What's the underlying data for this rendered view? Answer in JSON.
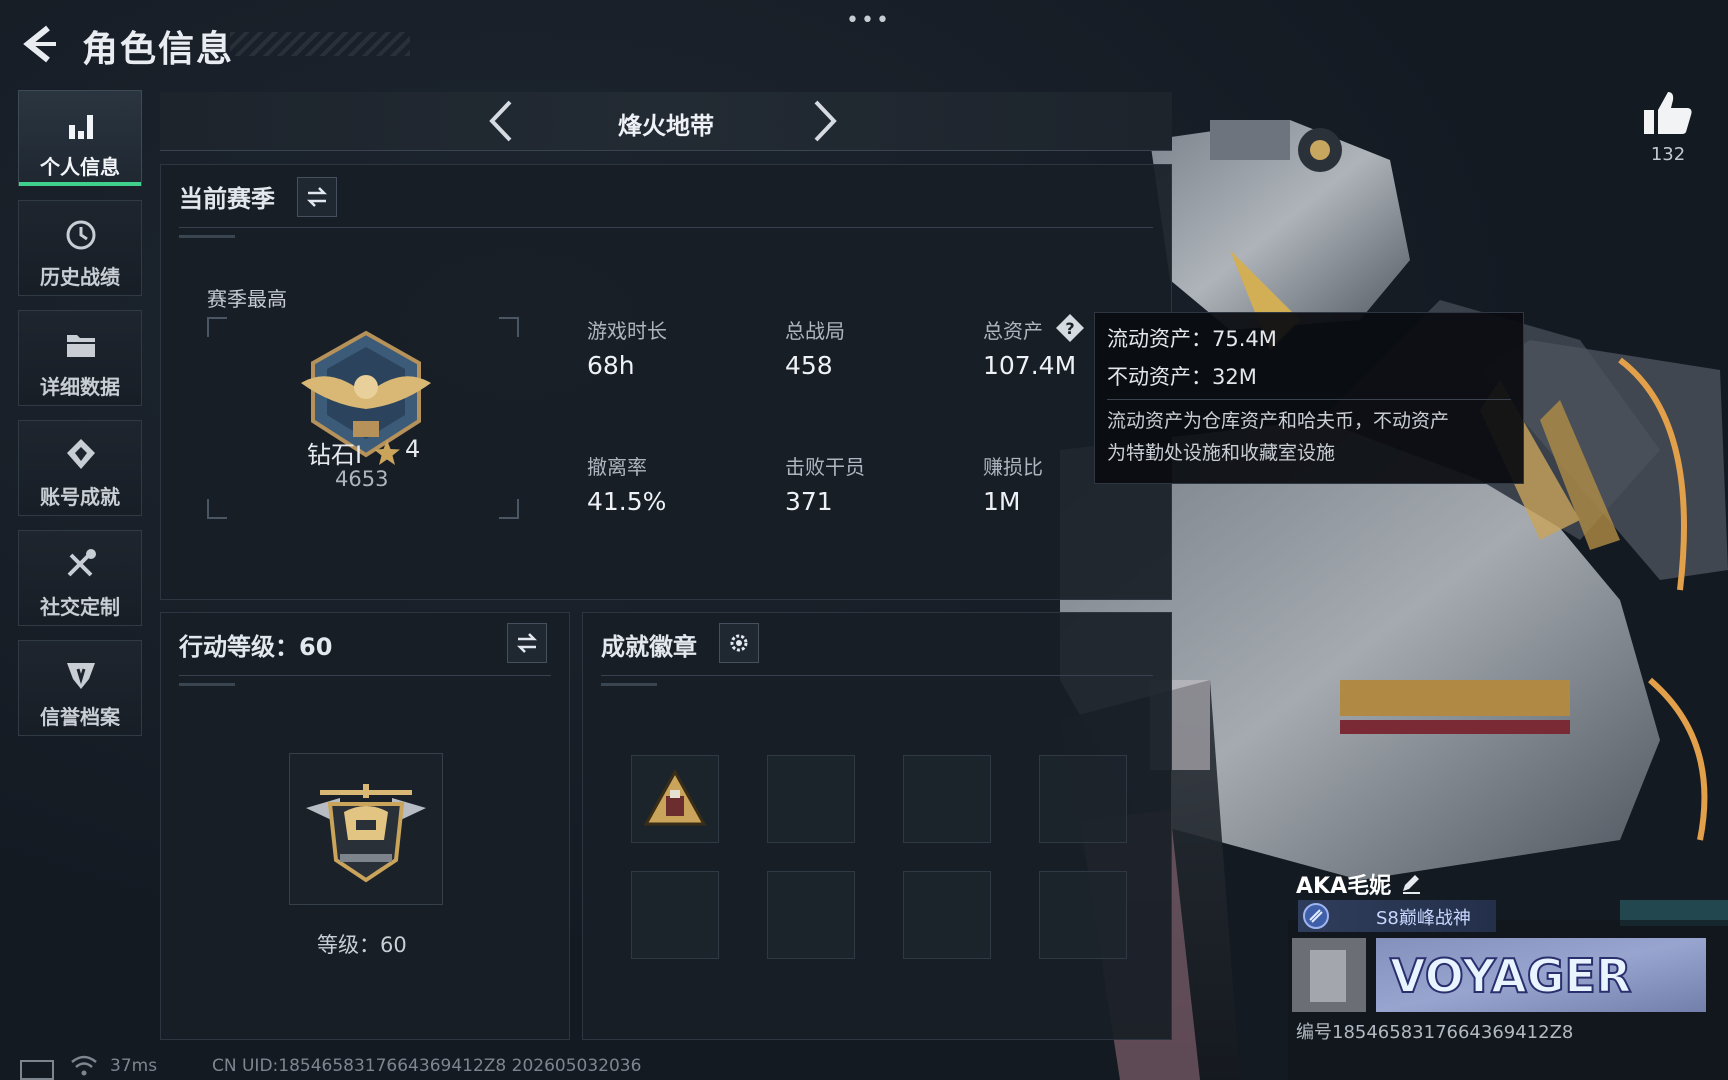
{
  "header": {
    "title": "角色信息",
    "menu_glyph": "•••"
  },
  "like": {
    "count": "132",
    "icon": "thumbs-up-icon"
  },
  "sidebar": {
    "items": [
      {
        "label": "个人信息",
        "icon": "bar-chart-icon",
        "active": true
      },
      {
        "label": "历史战绩",
        "icon": "history-clock-icon",
        "active": false
      },
      {
        "label": "详细数据",
        "icon": "folder-icon",
        "active": false
      },
      {
        "label": "账号成就",
        "icon": "achievement-badge-icon",
        "active": false
      },
      {
        "label": "社交定制",
        "icon": "tools-icon",
        "active": false
      },
      {
        "label": "信誉档案",
        "icon": "shield-icon",
        "active": false
      }
    ]
  },
  "mode": {
    "title": "烽火地带"
  },
  "season": {
    "title": "当前赛季",
    "best_label": "赛季最高",
    "rank_name": "钻石I",
    "rank_stars": "4",
    "rank_score": "4653",
    "stats": [
      {
        "label": "游戏时长",
        "value": "68h"
      },
      {
        "label": "总战局",
        "value": "458"
      },
      {
        "label": "总资产",
        "value": "107.4M"
      },
      {
        "label": "撤离率",
        "value": "41.5%"
      },
      {
        "label": "击败干员",
        "value": "371"
      },
      {
        "label": "赚损比",
        "value": "1M"
      }
    ]
  },
  "tooltip": {
    "liquid": "流动资产：75.4M",
    "fixed": "不动资产：32M",
    "desc_line1": "流动资产为仓库资产和哈夫币，不动资产",
    "desc_line2": "为特勤处设施和收藏室设施"
  },
  "action_level": {
    "title": "行动等级：60",
    "level_text": "等级：60"
  },
  "achievements": {
    "title": "成就徽章"
  },
  "player": {
    "name": "AKA毛妮",
    "title_tag": "S8巅峰战神",
    "id_line": "编号1854658317664369412Z8",
    "banner_text": "VOYAGER"
  },
  "footer": {
    "ping": "37ms",
    "uid": "CN UID:1854658317664369412Z8 202605032036"
  },
  "colors": {
    "accent_green": "#3fd18b",
    "background": "#141a22",
    "gold": "#c9a45a"
  }
}
